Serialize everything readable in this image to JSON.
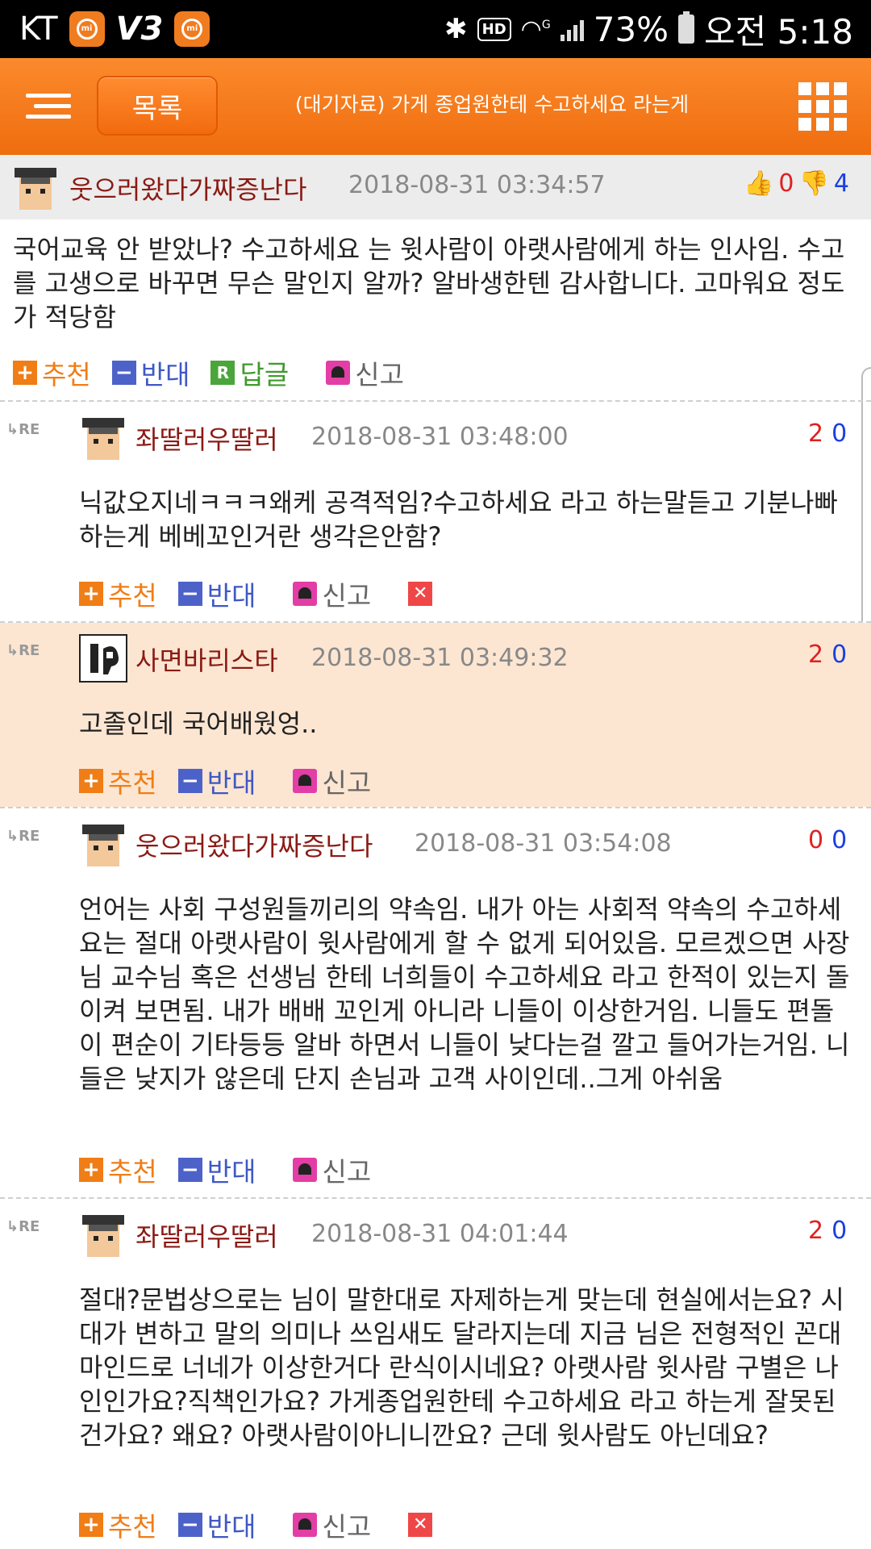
{
  "status_bar": {
    "carrier": "KT",
    "battery": "73%",
    "time": "오전 5:18",
    "hd_label": "HD",
    "network_label": "G"
  },
  "header": {
    "list_button": "목록",
    "title": "(대기자료) 가게 종업원한테 수고하세요 라는게"
  },
  "main_comment": {
    "nickname": "웃으러왔다가짜증난다",
    "date": "2018-08-31 03:34:57",
    "up_votes": "0",
    "down_votes": "4",
    "text": "국어교육 안 받았나? 수고하세요 는 윗사람이 아랫사람에게 하는 인사임. 수고를 고생으로 바꾸면 무슨 말인지 알까? 알바생한텐 감사합니다. 고마워요 정도가 적당함",
    "actions": {
      "recommend": "추천",
      "oppose": "반대",
      "reply": "답글",
      "report": "신고"
    }
  },
  "replies": [
    {
      "re_label": "RE",
      "nickname": "좌딸러우딸러",
      "date": "2018-08-31 03:48:00",
      "up_votes": "2",
      "down_votes": "0",
      "text": "닉값오지네ㅋㅋㅋ왜케 공격적임?수고하세요 라고 하는말듣고 기분나빠하는게 베베꼬인거란 생각은안함?",
      "recommend": "추천",
      "oppose": "반대",
      "report": "신고"
    },
    {
      "re_label": "RE",
      "nickname": "사면바리스타",
      "date": "2018-08-31 03:49:32",
      "up_votes": "2",
      "down_votes": "0",
      "text": "고졸인데 국어배웠엉..",
      "recommend": "추천",
      "oppose": "반대",
      "report": "신고"
    },
    {
      "re_label": "RE",
      "nickname": "웃으러왔다가짜증난다",
      "date": "2018-08-31 03:54:08",
      "up_votes": "0",
      "down_votes": "0",
      "text": "언어는 사회 구성원들끼리의 약속임. 내가 아는 사회적 약속의 수고하세요는 절대 아랫사람이 윗사람에게 할 수 없게 되어있음. 모르겠으면 사장님 교수님 혹은 선생님 한테 너희들이 수고하세요 라고 한적이 있는지 돌이켜 보면됨. 내가 배배 꼬인게 아니라 니들이 이상한거임. 니들도 편돌이 편순이 기타등등 알바 하면서 니들이 낮다는걸 깔고 들어가는거임. 니들은 낮지가 않은데 단지 손님과 고객 사이인데..그게 아쉬움",
      "recommend": "추천",
      "oppose": "반대",
      "report": "신고"
    },
    {
      "re_label": "RE",
      "nickname": "좌딸러우딸러",
      "date": "2018-08-31 04:01:44",
      "up_votes": "2",
      "down_votes": "0",
      "text": "절대?문법상으로는 님이 말한대로 자제하는게 맞는데 현실에서는요? 시대가 변하고 말의 의미나 쓰임새도 달라지는데 지금 님은 전형적인 꼰대마인드로 너네가 이상한거다 란식이시네요? 아랫사람 윗사람 구별은 나인인가요?직책인가요? 가게종업원한테 수고하세요 라고 하는게 잘못된건가요? 왜요? 아랫사람이아니니깐요? 근데 윗사람도 아닌데요?",
      "recommend": "추천",
      "oppose": "반대",
      "report": "신고"
    }
  ],
  "colors": {
    "header_orange": "#f47a1c",
    "nickname": "#8b1a14",
    "up_vote": "#e02020",
    "down_vote": "#1a3fe0",
    "highlight_bg": "#fce6d2"
  }
}
